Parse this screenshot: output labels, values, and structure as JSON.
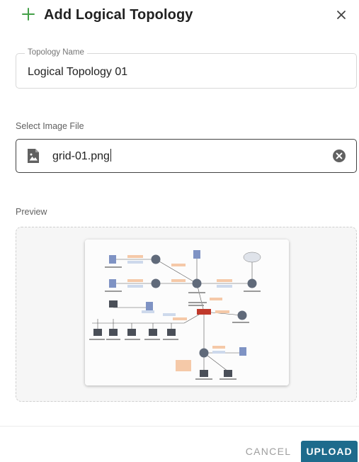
{
  "dialog": {
    "title": "Add Logical Topology"
  },
  "topology_name": {
    "label": "Topology Name",
    "value": "Logical Topology 01"
  },
  "image_file": {
    "label": "Select Image File",
    "value": "grid-01.png"
  },
  "preview": {
    "label": "Preview"
  },
  "actions": {
    "cancel_label": "CANCEL",
    "upload_label": "UPLOAD"
  },
  "colors": {
    "accent": "#43a047",
    "primary": "#1e6b8c",
    "text": "#212121",
    "muted": "#757575"
  },
  "icons": [
    "plus-icon",
    "close-icon",
    "image-file-icon",
    "clear-icon"
  ]
}
